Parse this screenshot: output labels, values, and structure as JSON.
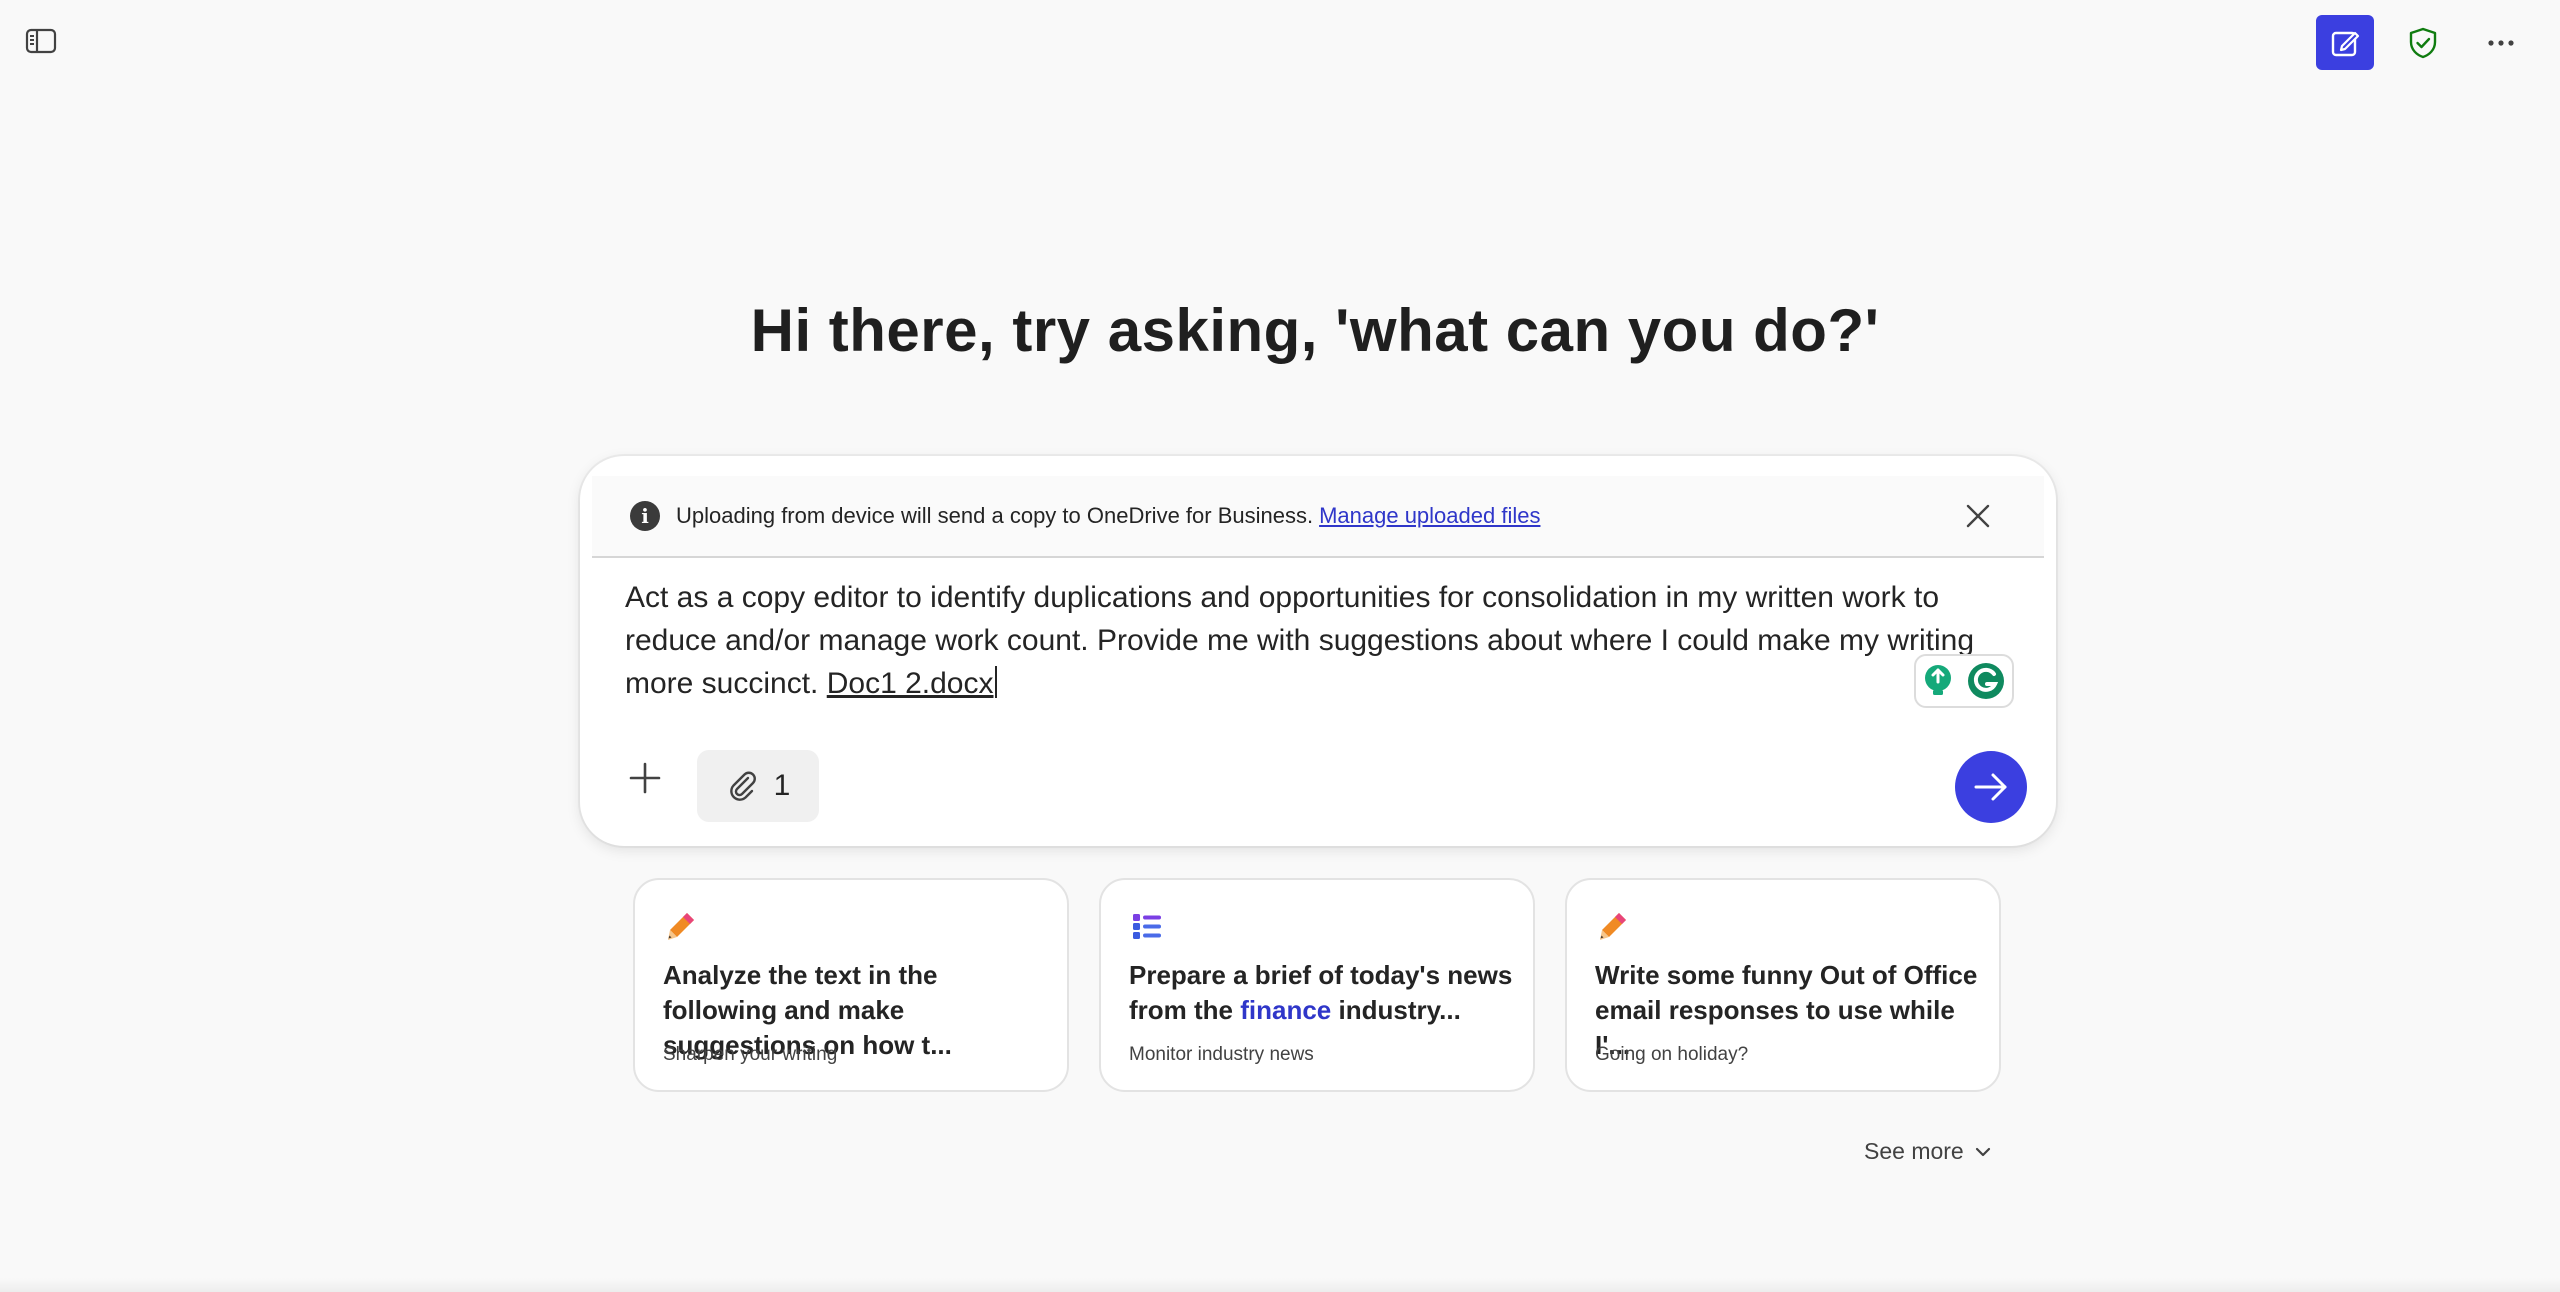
{
  "header": {
    "sidebar_toggle_icon": "sidebar-toggle-icon",
    "new_chat_icon": "compose-icon",
    "protection_icon": "shield-check-icon",
    "more_icon": "more-horizontal-icon",
    "accent_color": "#3b3fe0",
    "shield_color": "#107c10"
  },
  "hero": {
    "title": "Hi there, try asking, 'what can you do?'"
  },
  "composer": {
    "notice": {
      "text": "Uploading from device will send a copy to OneDrive for Business.",
      "link": "Manage uploaded files",
      "close_icon": "close-icon"
    },
    "prompt": "Act as a copy editor to identify duplications and opportunities for consolidation in my written work to reduce and/or manage work count. Provide me with suggestions about where I could make my writing more succinct. ",
    "attachment_name": "Doc1 2.docx",
    "attachment_count": "1",
    "add_icon": "plus-icon",
    "attach_icon": "paperclip-icon",
    "send_icon": "arrow-right-icon"
  },
  "cards": [
    {
      "icon": "pencil-icon",
      "title": "Analyze the text in the following and make suggestions on how t...",
      "subtitle": "Sharpen your writing"
    },
    {
      "icon": "list-icon",
      "title_before": "Prepare a brief of today's news from the ",
      "title_highlight": "finance",
      "title_after": " industry...",
      "subtitle": "Monitor industry news"
    },
    {
      "icon": "pencil-icon",
      "title": "Write some funny Out of Office email responses to use while I'...",
      "subtitle": "Going on holiday?"
    }
  ],
  "see_more": {
    "label": "See more",
    "icon": "chevron-down-icon"
  }
}
